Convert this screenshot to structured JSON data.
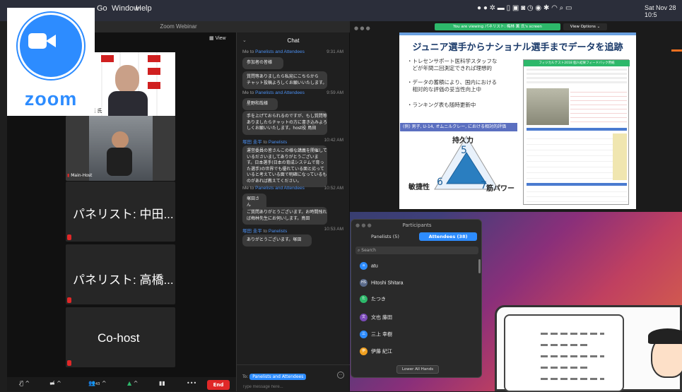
{
  "menubar": {
    "items": [
      "Go",
      "Window",
      "Help"
    ],
    "datetime": "Sat Nov 28 10:5"
  },
  "logo": {
    "word": "zoom"
  },
  "webinar": {
    "title": "Zoom Webinar",
    "view_label": "View"
  },
  "tiles": [
    {
      "name": "林 薫 氏"
    },
    {
      "name": "Main-Host"
    },
    {
      "name": "パネリスト: 中田..."
    },
    {
      "name": "パネリスト: 高橋..."
    },
    {
      "name": "Co-host"
    }
  ],
  "chat": {
    "title": "Chat",
    "messages": [
      {
        "from": "Me",
        "to": "Panelists and Attendees",
        "time": "9:31 AM",
        "bubbles": [
          "参加者の皆様",
          "質問等ありましたら私宛にこちらから\nチャット投稿よろしくお願いいたします。"
        ]
      },
      {
        "from": "Me",
        "to": "Panelists and Attendees",
        "time": "9:59 AM",
        "bubbles": [
          "星野和哉様",
          "手を上げておられるのですが、もし質問等\nありましたらチャットの方に書き込みよろ\nしくお願いいたします。host役 鳥田"
        ]
      },
      {
        "from": "塚田 圭平",
        "to": "Panelists",
        "time": "10:42 AM",
        "bubbles": [
          "運営委員の皆さんこの様な講義を開催して\nいるださいましてありがとうございま\nす。日本選手(日本の育成システムで育っ\nた選手)の世界でも優れている面と劣って\nいると考えている面で明確になっているも\nのがあれば教えてください。"
        ]
      },
      {
        "from": "Me",
        "to": "Panelists and Attendees",
        "time": "10:52 AM",
        "bubbles": [
          "塚田さん",
          "ご質問ありがとうございます。お時間残れ\nば梅林先生にお伺いします。鳥田"
        ]
      },
      {
        "from": "塚田 圭平",
        "to": "Panelists",
        "time": "10:53 AM",
        "bubbles": [
          "ありがとうございます。塚田"
        ]
      }
    ],
    "to_label": "To:",
    "to_value": "Panelists and Attendees",
    "placeholder": "Type message here..."
  },
  "screenshare": {
    "banner": "You are viewing パネリスト: 梅林 薫 氏's screen",
    "view_options": "View Options"
  },
  "slide": {
    "title": "ジュニア選手からナショナル選手までデータを追跡",
    "bullets": [
      "・トレセンサポート医科学スタッフな\n　どが年間二回測定できれば理想的",
      "・データの蓄積により、国内における\n　相対的な評価の妥当性向上中",
      "・ランキング表も随時更新中"
    ],
    "example": "(例) 男子, U-14, オムニルクレー, における相対的評価",
    "radar": {
      "top": "持久力",
      "left": "敏捷性",
      "right": "筋パワー",
      "n_top": "5",
      "n_left": "6",
      "n_right": "7"
    },
    "table_title": "フィジカルテスト2018 個人結果フィードバック用紙"
  },
  "participants": {
    "title": "Participants",
    "tab_panelists": "Panelists (5)",
    "tab_attendees": "Attendees (38)",
    "search": "Search",
    "list": [
      {
        "initial": "a",
        "name": "atu",
        "color": "#2d8cff"
      },
      {
        "initial": "HS",
        "name": "Hitoshi Shitara",
        "color": "#5a6a8a"
      },
      {
        "initial": "た",
        "name": "たつき",
        "color": "#2db86a"
      },
      {
        "initial": "文",
        "name": "文也 藤田",
        "color": "#7a4ab8"
      },
      {
        "initial": "三",
        "name": "三上 幸樹",
        "color": "#2d8cff"
      },
      {
        "initial": "伊",
        "name": "伊藤 紀江",
        "color": "#f0a020"
      }
    ],
    "lower_hands": "Lower All Hands"
  },
  "toolbar": {
    "count": "43",
    "end": "End"
  }
}
